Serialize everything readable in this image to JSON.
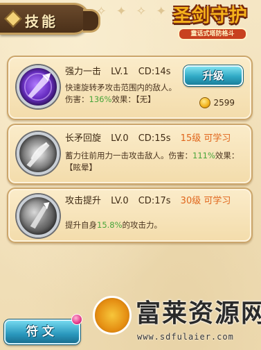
{
  "header": {
    "title": "技能",
    "emblem_icon": "diamond-icon"
  },
  "logo": {
    "main_text": "圣剑守护",
    "sub_text": "童话式塔防格斗"
  },
  "skills": [
    {
      "name": "强力一击",
      "level": "LV.1",
      "cd": "CD:14s",
      "requirement": "",
      "desc_line1": "快速旋转矛攻击范围内的敌人。",
      "damage_label": "伤害：",
      "damage_value": "136%",
      "effect_label": "效果：",
      "effect_value": "【无】",
      "icon": "spear-spin-icon"
    },
    {
      "name": "长矛回旋",
      "level": "LV.0",
      "cd": "CD:15s",
      "requirement": "15级 可学习",
      "desc_line1": "蓄力往前用力一击攻击敌人。伤害：",
      "damage_value": "111%",
      "effect_label": "效果：",
      "effect_value": "【眩晕】",
      "icon": "spear-thrust-icon"
    },
    {
      "name": "攻击提升",
      "level": "LV.0",
      "cd": "CD:17s",
      "requirement": "30级 可学习",
      "desc_prefix": "提升自身",
      "desc_value": "15.8%",
      "desc_suffix": "的攻击力。",
      "icon": "attack-boost-icon"
    }
  ],
  "upgrade": {
    "label": "升级",
    "cost": "2599",
    "coin_icon": "gold-coin-icon"
  },
  "rune_button": {
    "label": "符文"
  },
  "watermark": {
    "title": "富莱资源网",
    "url": "www.sdfulaier.com"
  },
  "colors": {
    "accent_green": "#48a53a",
    "requirement_orange": "#e0651b",
    "button_blue": "#2fa9c4"
  }
}
